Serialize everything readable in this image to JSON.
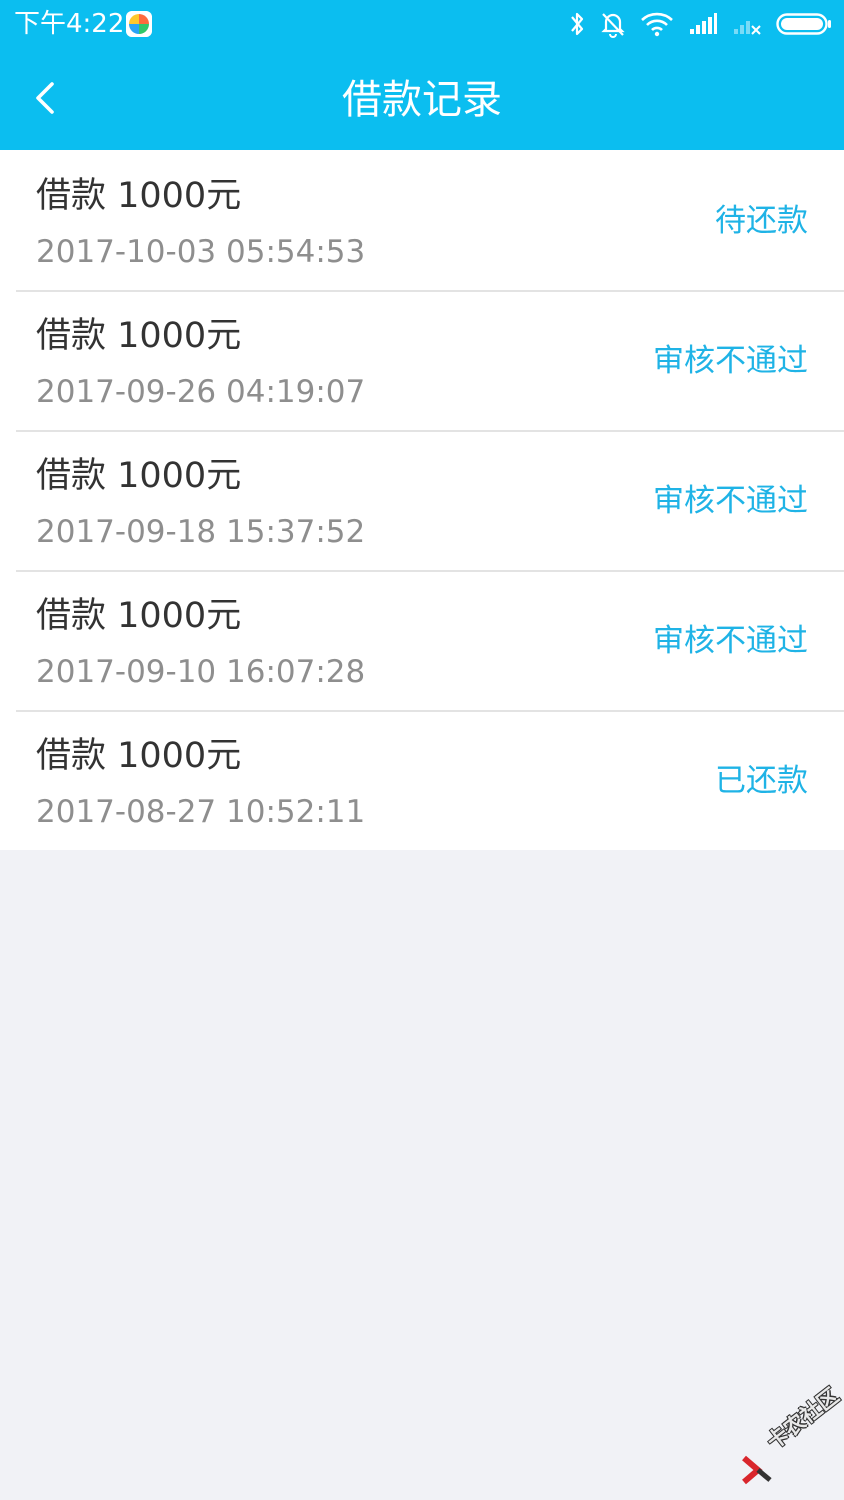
{
  "status_bar": {
    "time": "下午4:22",
    "icons": [
      "app-icon",
      "bluetooth-icon",
      "mute-bell-icon",
      "wifi-icon",
      "signal-icon",
      "signal-no-sim-icon",
      "battery-icon"
    ]
  },
  "header": {
    "title": "借款记录",
    "back_icon": "chevron-left-icon"
  },
  "records": [
    {
      "title": "借款 1000元",
      "date": "2017-10-03 05:54:53",
      "status": "待还款"
    },
    {
      "title": "借款 1000元",
      "date": "2017-09-26 04:19:07",
      "status": "审核不通过"
    },
    {
      "title": "借款 1000元",
      "date": "2017-09-18 15:37:52",
      "status": "审核不通过"
    },
    {
      "title": "借款 1000元",
      "date": "2017-09-10 16:07:28",
      "status": "审核不通过"
    },
    {
      "title": "借款 1000元",
      "date": "2017-08-27 10:52:11",
      "status": "已还款"
    }
  ],
  "watermark": {
    "text": "卡农社区"
  },
  "colors": {
    "header_bg": "#0bbef0",
    "status_text": "#1fb3e6",
    "page_bg": "#f1f2f6"
  }
}
